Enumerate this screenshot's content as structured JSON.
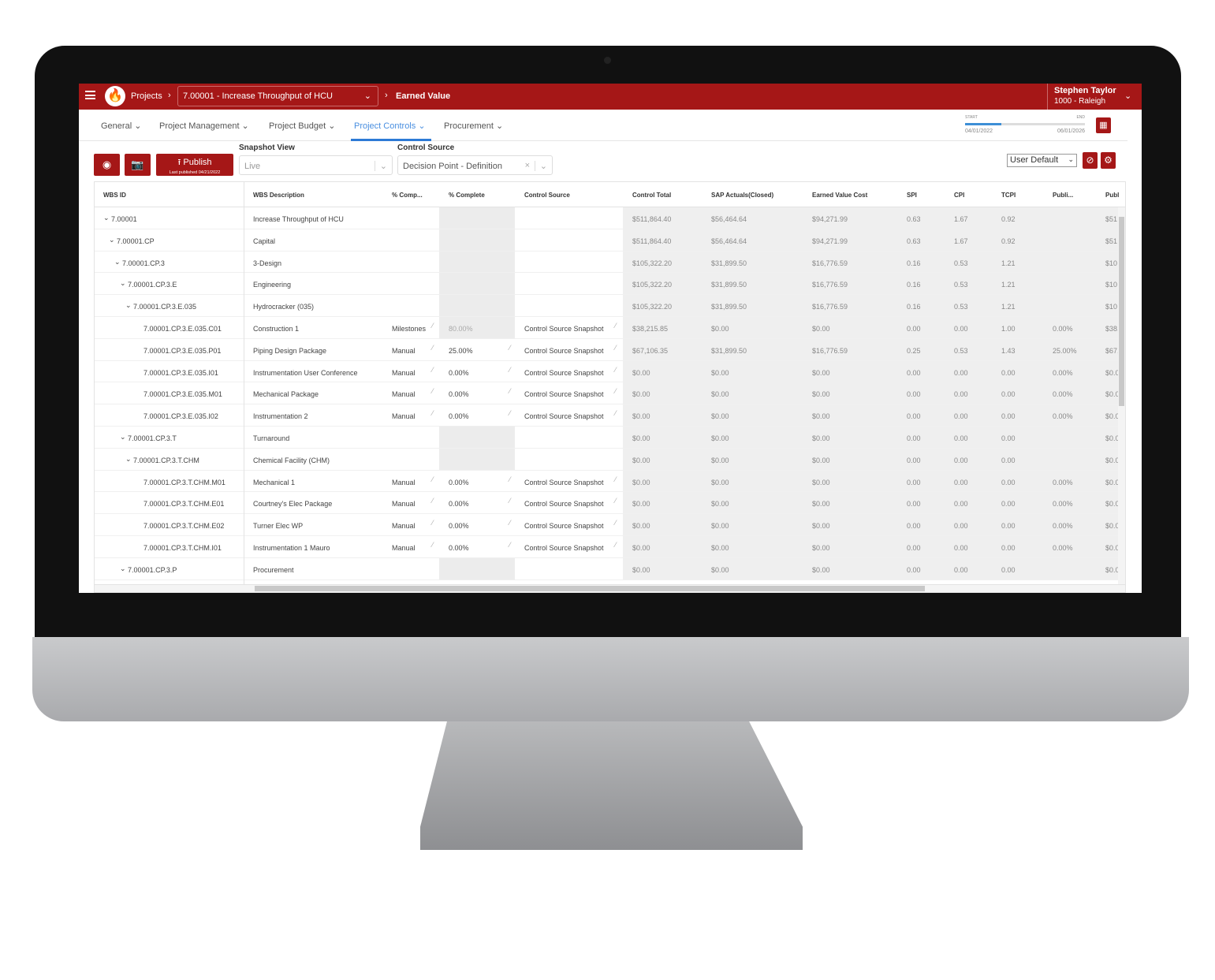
{
  "topbar": {
    "crumb_projects": "Projects",
    "project": "7.00001 - Increase Throughput of HCU",
    "page": "Earned Value",
    "user_name": "Stephen Taylor",
    "user_org": "1000 - Raleigh"
  },
  "nav": [
    {
      "label": "General"
    },
    {
      "label": "Project Management"
    },
    {
      "label": "Project Budget"
    },
    {
      "label": "Project Controls",
      "active": true
    },
    {
      "label": "Procurement"
    }
  ],
  "timeline": {
    "start_label": "START",
    "end_label": "END",
    "start": "04/01/2022",
    "end": "06/01/2026",
    "progress_pct": 30
  },
  "toolbar": {
    "publish_label": "Publish",
    "last_published": "Last published 04/21/2022",
    "snapshot_label": "Snapshot View",
    "snapshot_value": "Live",
    "control_source_label": "Control Source",
    "control_source_value": "Decision Point - Definition",
    "layout_value": "User Default"
  },
  "columns": [
    "WBS ID",
    "WBS Description",
    "% Comp...",
    "% Complete",
    "Control Source",
    "Control Total",
    "SAP Actuals(Closed)",
    "Earned Value Cost",
    "SPI",
    "CPI",
    "TCPI",
    "Publi...",
    "Publish"
  ],
  "rows": [
    [
      "7.00001",
      0,
      true,
      "Increase Throughput of HCU",
      "",
      "",
      "",
      "$511,864.40",
      "$56,464.64",
      "$94,271.99",
      "0.63",
      "1.67",
      "0.92",
      "",
      "$51"
    ],
    [
      "7.00001.CP",
      1,
      true,
      "Capital",
      "",
      "",
      "",
      "$511,864.40",
      "$56,464.64",
      "$94,271.99",
      "0.63",
      "1.67",
      "0.92",
      "",
      "$51"
    ],
    [
      "7.00001.CP.3",
      2,
      true,
      "3-Design",
      "",
      "",
      "",
      "$105,322.20",
      "$31,899.50",
      "$16,776.59",
      "0.16",
      "0.53",
      "1.21",
      "",
      "$10"
    ],
    [
      "7.00001.CP.3.E",
      3,
      true,
      "Engineering",
      "",
      "",
      "",
      "$105,322.20",
      "$31,899.50",
      "$16,776.59",
      "0.16",
      "0.53",
      "1.21",
      "",
      "$10"
    ],
    [
      "7.00001.CP.3.E.035",
      4,
      true,
      "Hydrocracker (035)",
      "",
      "",
      "",
      "$105,322.20",
      "$31,899.50",
      "$16,776.59",
      "0.16",
      "0.53",
      "1.21",
      "",
      "$10"
    ],
    [
      "7.00001.CP.3.E.035.C01",
      5,
      false,
      "Construction 1",
      "Milestones",
      "80.00%",
      "Control Source Snapshot",
      "$38,215.85",
      "$0.00",
      "$0.00",
      "0.00",
      "0.00",
      "1.00",
      "0.00%",
      "$38,"
    ],
    [
      "7.00001.CP.3.E.035.P01",
      5,
      false,
      "Piping Design Package",
      "Manual",
      "25.00%",
      "Control Source Snapshot",
      "$67,106.35",
      "$31,899.50",
      "$16,776.59",
      "0.25",
      "0.53",
      "1.43",
      "25.00%",
      "$67,"
    ],
    [
      "7.00001.CP.3.E.035.I01",
      5,
      false,
      "Instrumentation User Conference",
      "Manual",
      "0.00%",
      "Control Source Snapshot",
      "$0.00",
      "$0.00",
      "$0.00",
      "0.00",
      "0.00",
      "0.00",
      "0.00%",
      "$0.0"
    ],
    [
      "7.00001.CP.3.E.035.M01",
      5,
      false,
      "Mechanical Package",
      "Manual",
      "0.00%",
      "Control Source Snapshot",
      "$0.00",
      "$0.00",
      "$0.00",
      "0.00",
      "0.00",
      "0.00",
      "0.00%",
      "$0.0"
    ],
    [
      "7.00001.CP.3.E.035.I02",
      5,
      false,
      "Instrumentation 2",
      "Manual",
      "0.00%",
      "Control Source Snapshot",
      "$0.00",
      "$0.00",
      "$0.00",
      "0.00",
      "0.00",
      "0.00",
      "0.00%",
      "$0.0"
    ],
    [
      "7.00001.CP.3.T",
      3,
      true,
      "Turnaround",
      "",
      "",
      "",
      "$0.00",
      "$0.00",
      "$0.00",
      "0.00",
      "0.00",
      "0.00",
      "",
      "$0.0"
    ],
    [
      "7.00001.CP.3.T.CHM",
      4,
      true,
      "Chemical Facility (CHM)",
      "",
      "",
      "",
      "$0.00",
      "$0.00",
      "$0.00",
      "0.00",
      "0.00",
      "0.00",
      "",
      "$0.0"
    ],
    [
      "7.00001.CP.3.T.CHM.M01",
      5,
      false,
      "Mechanical 1",
      "Manual",
      "0.00%",
      "Control Source Snapshot",
      "$0.00",
      "$0.00",
      "$0.00",
      "0.00",
      "0.00",
      "0.00",
      "0.00%",
      "$0.0"
    ],
    [
      "7.00001.CP.3.T.CHM.E01",
      5,
      false,
      "Courtney's Elec Package",
      "Manual",
      "0.00%",
      "Control Source Snapshot",
      "$0.00",
      "$0.00",
      "$0.00",
      "0.00",
      "0.00",
      "0.00",
      "0.00%",
      "$0.0"
    ],
    [
      "7.00001.CP.3.T.CHM.E02",
      5,
      false,
      "Turner Elec WP",
      "Manual",
      "0.00%",
      "Control Source Snapshot",
      "$0.00",
      "$0.00",
      "$0.00",
      "0.00",
      "0.00",
      "0.00",
      "0.00%",
      "$0.0"
    ],
    [
      "7.00001.CP.3.T.CHM.I01",
      5,
      false,
      "Instrumentation 1 Mauro",
      "Manual",
      "0.00%",
      "Control Source Snapshot",
      "$0.00",
      "$0.00",
      "$0.00",
      "0.00",
      "0.00",
      "0.00",
      "0.00%",
      "$0.0"
    ],
    [
      "7.00001.CP.3.P",
      3,
      true,
      "Procurement",
      "",
      "",
      "",
      "$0.00",
      "$0.00",
      "$0.00",
      "0.00",
      "0.00",
      "0.00",
      "",
      "$0.0"
    ]
  ],
  "colors": {
    "brand": "#a51717",
    "accent": "#2d7ad6"
  }
}
